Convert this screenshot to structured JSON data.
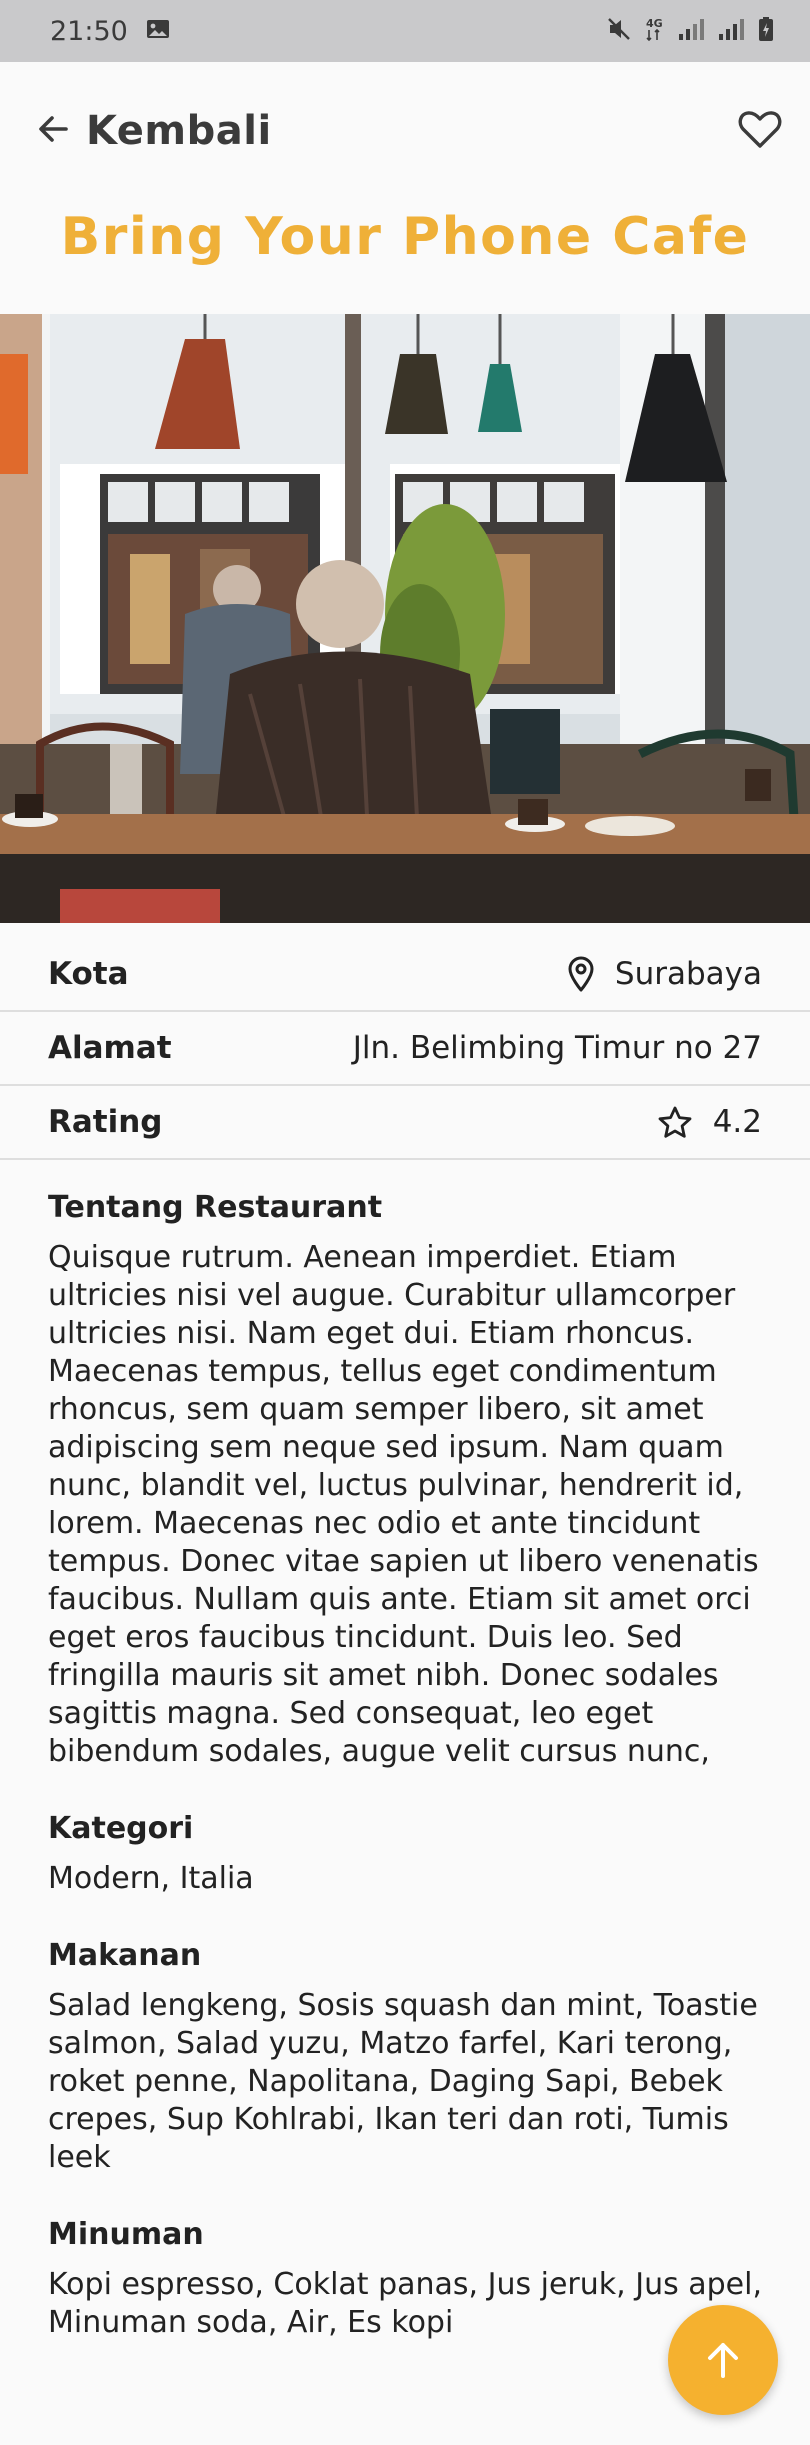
{
  "status_bar": {
    "time": "21:50",
    "network": "4G"
  },
  "header": {
    "back_label": "Kembali"
  },
  "title": "Bring Your Phone Cafe",
  "details": {
    "kota": {
      "label": "Kota",
      "value": "Surabaya"
    },
    "alamat": {
      "label": "Alamat",
      "value": "Jln. Belimbing Timur no 27"
    },
    "rating": {
      "label": "Rating",
      "value": "4.2"
    }
  },
  "about": {
    "heading": "Tentang Restaurant",
    "text": "Quisque rutrum. Aenean imperdiet. Etiam ultricies nisi vel augue. Curabitur ullamcorper ultricies nisi. Nam eget dui. Etiam rhoncus. Maecenas tempus, tellus eget condimentum rhoncus, sem quam semper libero, sit amet adipiscing sem neque sed ipsum. Nam quam nunc, blandit vel, luctus pulvinar, hendrerit id, lorem. Maecenas nec odio et ante tincidunt tempus. Donec vitae sapien ut libero venenatis faucibus. Nullam quis ante. Etiam sit amet orci eget eros faucibus tincidunt. Duis leo. Sed fringilla mauris sit amet nibh. Donec sodales sagittis magna. Sed consequat, leo eget bibendum sodales, augue velit cursus nunc,"
  },
  "kategori": {
    "heading": "Kategori",
    "text": "Modern, Italia"
  },
  "makanan": {
    "heading": "Makanan",
    "text": "Salad lengkeng, Sosis squash dan mint, Toastie salmon, Salad yuzu, Matzo farfel, Kari terong, roket penne, Napolitana, Daging Sapi, Bebek crepes, Sup Kohlrabi, Ikan teri dan roti, Tumis leek"
  },
  "minuman": {
    "heading": "Minuman",
    "text": "Kopi espresso, Coklat panas, Jus jeruk, Jus apel, Minuman soda, Air, Es kopi"
  },
  "icons": {
    "back": "arrow-left-icon",
    "favorite": "heart-outline-icon",
    "location": "map-pin-icon",
    "rating": "star-outline-icon",
    "fab": "arrow-up-icon"
  },
  "colors": {
    "accent": "#efb038",
    "fab": "#f5b12f",
    "status_bar": "#c9c9cb"
  }
}
